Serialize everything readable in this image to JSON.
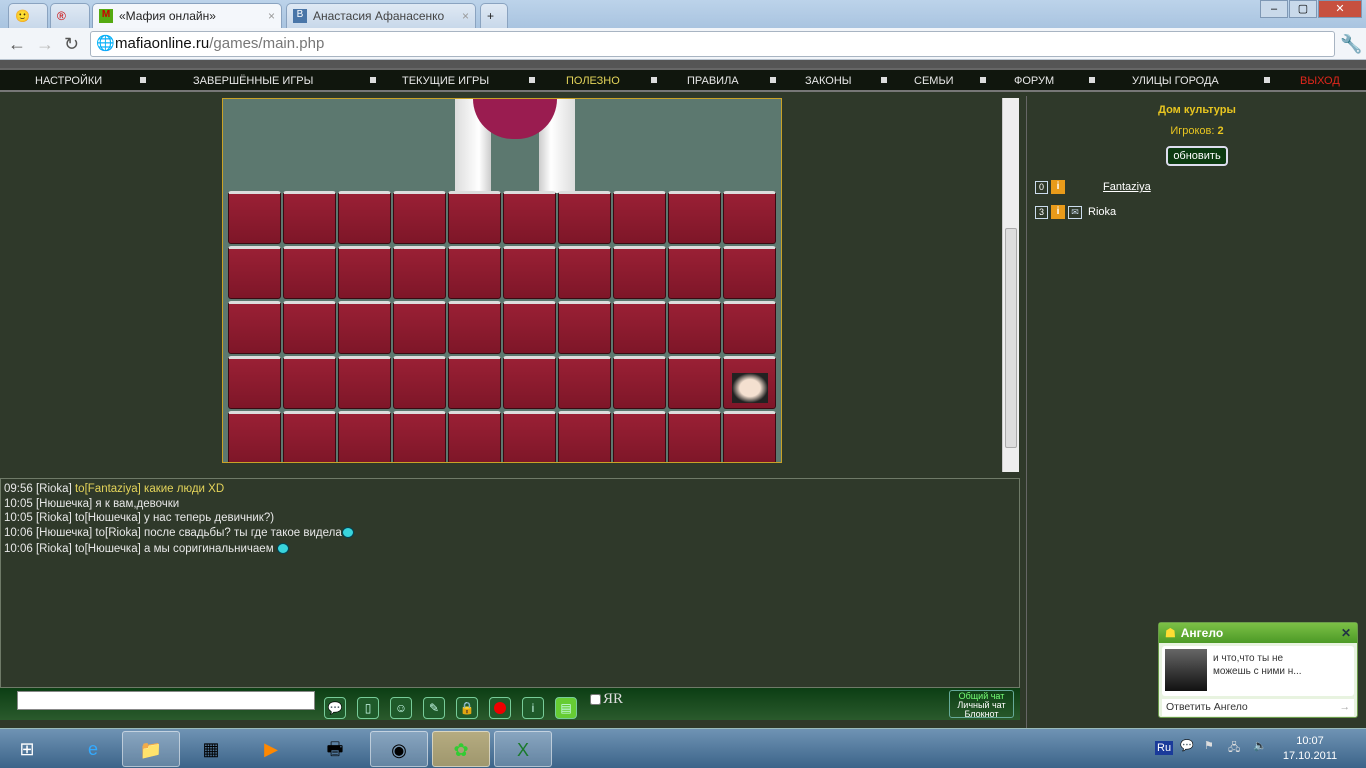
{
  "browser": {
    "tabs": [
      {
        "title": ""
      },
      {
        "title": ""
      },
      {
        "title": "«Мафия онлайн»",
        "active": true
      },
      {
        "title": "Анастасия Афанасенко"
      }
    ],
    "url_host": "mafiaonline.ru",
    "url_path": "/games/main.php"
  },
  "menu": [
    {
      "label": "НАСТРОЙКИ"
    },
    {
      "label": "ЗАВЕРШЁННЫЕ ИГРЫ"
    },
    {
      "label": "ТЕКУЩИЕ ИГРЫ"
    },
    {
      "label": "ПОЛЕЗНО",
      "color": "#e4d45a"
    },
    {
      "label": "ПРАВИЛА"
    },
    {
      "label": "ЗАКОНЫ"
    },
    {
      "label": "СЕМЬИ"
    },
    {
      "label": "ФОРУМ"
    },
    {
      "label": "УЛИЦЫ ГОРОДА"
    },
    {
      "label": "ВЫХОД",
      "color": "#e0271c"
    }
  ],
  "chat": [
    {
      "time": "09:56",
      "from": "[Rioka]",
      "to": "to[Fantaziya]",
      "text": "какие люди XD",
      "highlight": true
    },
    {
      "time": "10:05",
      "from": "[Нюшечка]",
      "to": "",
      "text": "я к вам,девочки"
    },
    {
      "time": "10:05",
      "from": "[Rioka]",
      "to": "to[Нюшечка]",
      "text": "у нас теперь девичник?)"
    },
    {
      "time": "10:06",
      "from": "[Нюшечка]",
      "to": "to[Rioka]",
      "text": "после свадьбы? ты где такое видела",
      "smile": true
    },
    {
      "time": "10:06",
      "from": "[Rioka]",
      "to": "to[Нюшечка]",
      "text": "а мы сориги­нальничаем ",
      "smile": true
    }
  ],
  "chat_input": {
    "value": ""
  },
  "chat_translit": "ЯR",
  "chat_modes": [
    "Общий чат",
    "Личный чат",
    "Блокнот"
  ],
  "room": {
    "name": "Дом культуры",
    "players_label": "Игроков:",
    "players_count": "2",
    "refresh": "обновить",
    "players": [
      {
        "num": "0",
        "name": "Fantaziya",
        "link": true
      },
      {
        "num": "3",
        "name": "Rioka",
        "mail": true
      }
    ]
  },
  "notification": {
    "sender": "Ангело",
    "message": "и что,что ты не можешь с ними н...",
    "reply": "Ответить Ангело"
  },
  "tray": {
    "lang": "Ru",
    "time": "10:07",
    "date": "17.10.2011"
  }
}
